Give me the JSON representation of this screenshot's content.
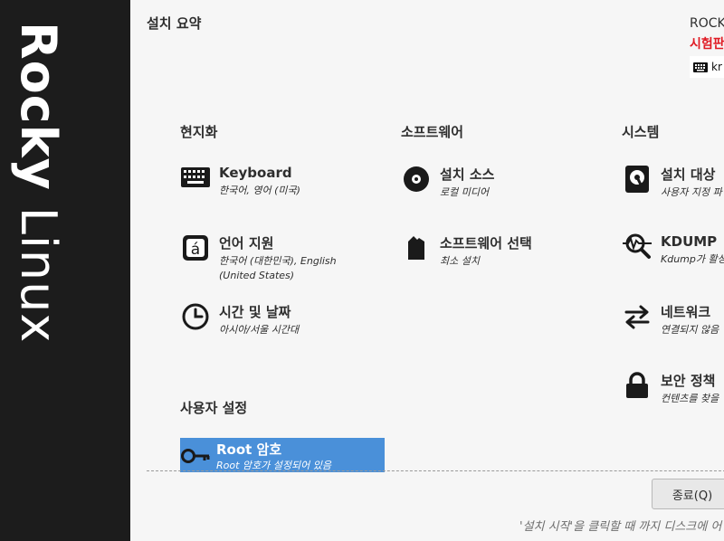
{
  "sidebar": {
    "brand_bold": "Rocky",
    "brand_light": "Linux"
  },
  "header": {
    "title": "설치 요약",
    "product": "ROCK",
    "prerelease": "시험판",
    "keyboard_layout": "kr"
  },
  "sections": {
    "localization": {
      "title": "현지화",
      "keyboard": {
        "title": "Keyboard",
        "status": "한국어, 영어 (미국)",
        "icon": "keyboard-icon"
      },
      "language": {
        "title": "언어 지원",
        "status_line1": "한국어 (대한민국), English",
        "status_line2": "(United States)",
        "icon": "language-icon"
      },
      "datetime": {
        "title": "시간 및 날짜",
        "status": "아시아/서울 시간대",
        "icon": "clock-icon"
      }
    },
    "software": {
      "title": "소프트웨어",
      "source": {
        "title": "설치 소스",
        "status": "로컬 미디어",
        "icon": "disc-icon"
      },
      "selection": {
        "title": "소프트웨어 선택",
        "status": "최소 설치",
        "icon": "package-icon"
      }
    },
    "system": {
      "title": "시스템",
      "destination": {
        "title": "설치 대상",
        "status": "사용자 지정 파",
        "icon": "harddisk-icon"
      },
      "kdump": {
        "title": "KDUMP",
        "status": "Kdump가 활성",
        "icon": "kdump-search-icon"
      },
      "network": {
        "title": "네트워크",
        "status": "연결되지 않음",
        "icon": "network-arrows-icon"
      },
      "security": {
        "title": "보안 정책",
        "status": "컨텐츠를 찾을",
        "icon": "lock-icon"
      }
    },
    "user": {
      "title": "사용자 설정",
      "root": {
        "title": "Root 암호",
        "status": "Root 암호가 설정되어 있음",
        "icon": "key-icon"
      }
    }
  },
  "footer": {
    "quit_label": "종료(Q)",
    "hint": "'설치 시작'을 클릭할 때 까지 디스크에 어"
  },
  "colors": {
    "sidebar": "#1c1c1c",
    "selected": "#4a90d9",
    "prerelease": "#e01b24",
    "background": "#f6f6f6"
  }
}
